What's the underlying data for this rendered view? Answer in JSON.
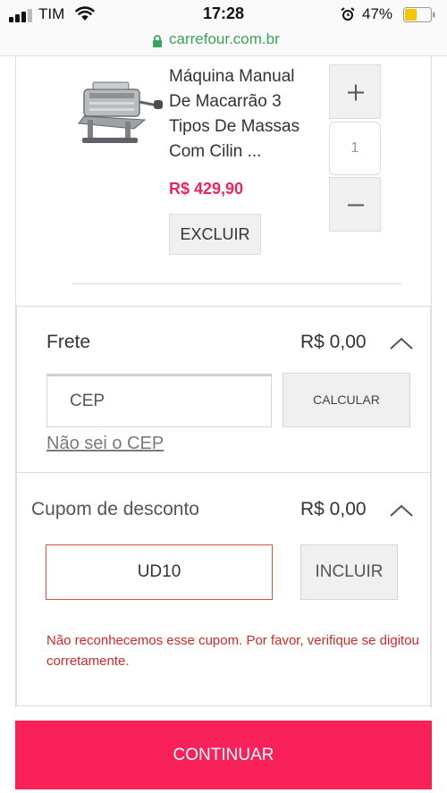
{
  "status_bar": {
    "carrier": "TIM",
    "time": "17:28",
    "battery_percent": "47%",
    "battery_level": 0.47,
    "battery_color": "#f5c400",
    "signal_icon": "cellular-signal-icon",
    "wifi_icon": "wifi-icon",
    "alarm_icon": "alarm-clock-icon"
  },
  "browser": {
    "url": "carrefour.com.br",
    "lock_icon": "lock-icon",
    "url_color": "#3aa35b"
  },
  "cart_item": {
    "title": "Máquina Manual De Macarrão 3 Tipos De Massas Com Cilin ...",
    "price": "R$ 429,90",
    "price_color": "#e8275a",
    "remove_label": "EXCLUIR",
    "quantity": "1",
    "increment_icon": "plus-icon",
    "decrement_icon": "minus-icon",
    "image_icon": "pasta-machine-product-image"
  },
  "shipping": {
    "label": "Frete",
    "value": "R$ 0,00",
    "zip_placeholder": "CEP",
    "calculate_label": "CALCULAR",
    "unknown_zip_link": "Não sei o CEP",
    "toggle_icon": "chevron-up-icon"
  },
  "coupon": {
    "label": "Cupom de desconto",
    "value": "R$ 0,00",
    "code": "UD10",
    "apply_label": "INCLUIR",
    "error_message": "Não reconhecemos esse cupom. Por favor, verifique se digitou corretamente.",
    "error_color": "#cc2a2a",
    "toggle_icon": "chevron-up-icon"
  },
  "footer": {
    "continue_label": "CONTINUAR",
    "button_color": "#f8215a"
  }
}
